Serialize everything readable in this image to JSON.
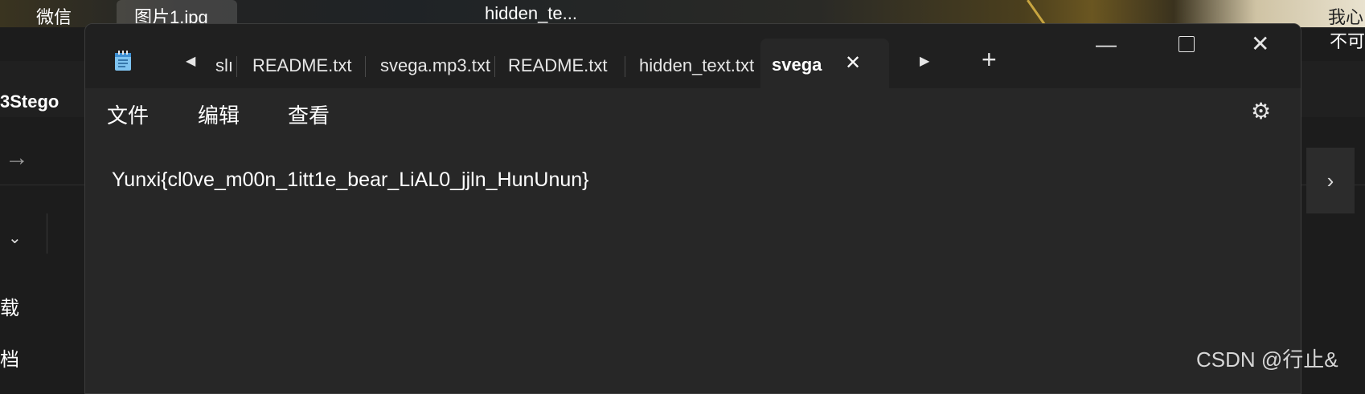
{
  "taskbar": {
    "wechat_label": "微信",
    "image_tab_label": "图片1.jpg",
    "hidden_label": "hidden_te...",
    "right_top": "我心",
    "right_bottom": "不可"
  },
  "explorer": {
    "title": "3Stego",
    "left_item_1": "载",
    "left_item_2": "档",
    "chevron": "⌄",
    "next_glyph": "›",
    "back_glyph": "→"
  },
  "notepad": {
    "tabs": [
      {
        "label": "slı"
      },
      {
        "label": "README.txt"
      },
      {
        "label": "svega.mp3.txt"
      },
      {
        "label": "README.txt"
      },
      {
        "label": "hidden_text.txt"
      }
    ],
    "active_tab": {
      "label": "svega",
      "close_glyph": "✕"
    },
    "prev_glyph": "◀",
    "next_glyph": "▶",
    "add_glyph": "+",
    "window_controls": {
      "minimize": "—",
      "close": "✕"
    },
    "menu": {
      "file": "文件",
      "edit": "编辑",
      "view": "查看"
    },
    "settings_glyph": "⚙",
    "content": "Yunxi{cl0ve_m00n_1itt1e_bear_LiAL0_jjln_HunUnun}"
  },
  "watermark": "CSDN @行止&"
}
